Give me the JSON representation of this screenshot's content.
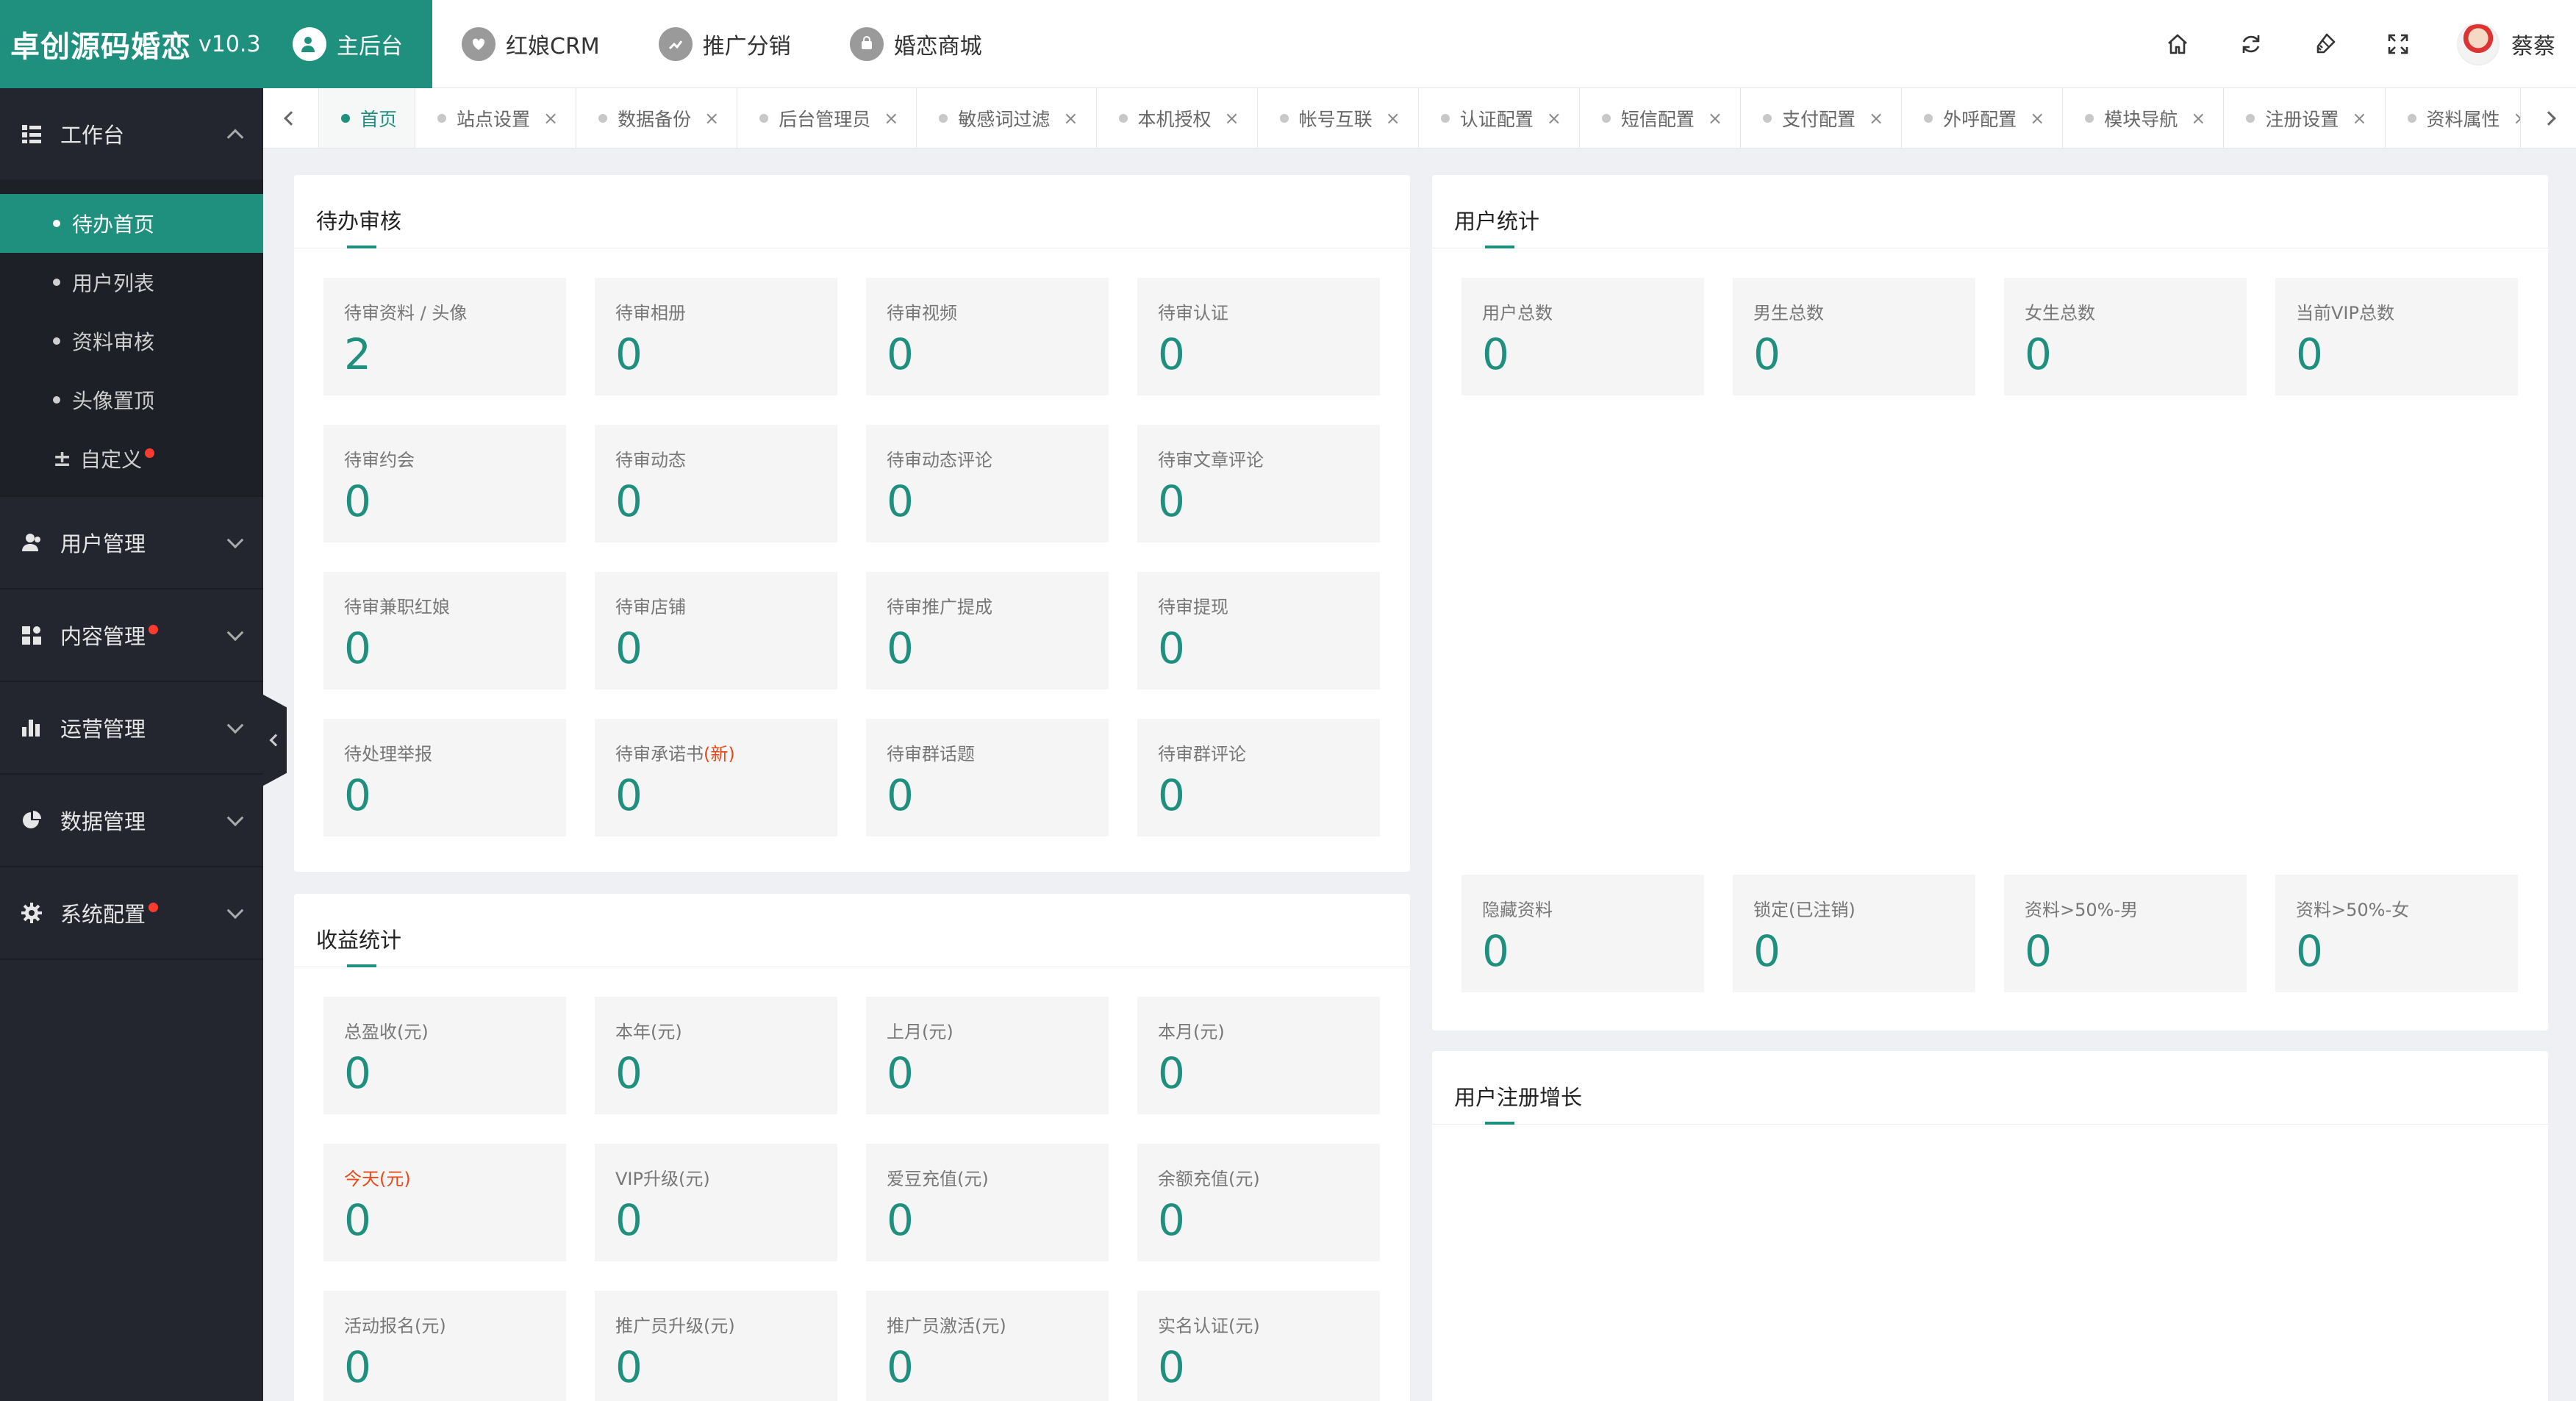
{
  "brand": {
    "name": "卓创源码婚恋",
    "version": "v10.3"
  },
  "sidebar": {
    "workbench": {
      "label": "工作台",
      "items": [
        {
          "label": "待办首页"
        },
        {
          "label": "用户列表"
        },
        {
          "label": "资料审核"
        },
        {
          "label": "头像置顶"
        },
        {
          "label": "自定义"
        }
      ]
    },
    "groups": [
      {
        "label": "用户管理"
      },
      {
        "label": "内容管理"
      },
      {
        "label": "运营管理"
      },
      {
        "label": "数据管理"
      },
      {
        "label": "系统配置"
      }
    ]
  },
  "topbar": {
    "tabs": [
      {
        "label": "主后台"
      },
      {
        "label": "红娘CRM"
      },
      {
        "label": "推广分销"
      },
      {
        "label": "婚恋商城"
      }
    ],
    "username": "蔡蔡"
  },
  "page_tabs": [
    {
      "label": "首页"
    },
    {
      "label": "站点设置"
    },
    {
      "label": "数据备份"
    },
    {
      "label": "后台管理员"
    },
    {
      "label": "敏感词过滤"
    },
    {
      "label": "本机授权"
    },
    {
      "label": "帐号互联"
    },
    {
      "label": "认证配置"
    },
    {
      "label": "短信配置"
    },
    {
      "label": "支付配置"
    },
    {
      "label": "外呼配置"
    },
    {
      "label": "模块导航"
    },
    {
      "label": "注册设置"
    },
    {
      "label": "资料属性"
    }
  ],
  "pending": {
    "title": "待办审核",
    "cards": [
      {
        "label": "待审资料 / 头像",
        "value": "2"
      },
      {
        "label": "待审相册",
        "value": "0"
      },
      {
        "label": "待审视频",
        "value": "0"
      },
      {
        "label": "待审认证",
        "value": "0"
      },
      {
        "label": "待审约会",
        "value": "0"
      },
      {
        "label": "待审动态",
        "value": "0"
      },
      {
        "label": "待审动态评论",
        "value": "0"
      },
      {
        "label": "待审文章评论",
        "value": "0"
      },
      {
        "label": "待审兼职红娘",
        "value": "0"
      },
      {
        "label": "待审店铺",
        "value": "0"
      },
      {
        "label": "待审推广提成",
        "value": "0"
      },
      {
        "label": "待审提现",
        "value": "0"
      },
      {
        "label": "待处理举报",
        "value": "0"
      },
      {
        "label": "待审承诺书",
        "label_suffix": "(新)",
        "value": "0"
      },
      {
        "label": "待审群话题",
        "value": "0"
      },
      {
        "label": "待审群评论",
        "value": "0"
      }
    ]
  },
  "revenue": {
    "title": "收益统计",
    "cards": [
      {
        "label": "总盈收(元)",
        "value": "0"
      },
      {
        "label": "本年(元)",
        "value": "0"
      },
      {
        "label": "上月(元)",
        "value": "0"
      },
      {
        "label": "本月(元)",
        "value": "0"
      },
      {
        "label": "今天(元)",
        "value": "0"
      },
      {
        "label": "VIP升级(元)",
        "value": "0"
      },
      {
        "label": "爱豆充值(元)",
        "value": "0"
      },
      {
        "label": "余额充值(元)",
        "value": "0"
      },
      {
        "label": "活动报名(元)",
        "value": "0"
      },
      {
        "label": "推广员升级(元)",
        "value": "0"
      },
      {
        "label": "推广员激活(元)",
        "value": "0"
      },
      {
        "label": "实名认证(元)",
        "value": "0"
      }
    ]
  },
  "user_stats": {
    "title": "用户统计",
    "top_cards": [
      {
        "label": "用户总数",
        "value": "0"
      },
      {
        "label": "男生总数",
        "value": "0"
      },
      {
        "label": "女生总数",
        "value": "0"
      },
      {
        "label": "当前VIP总数",
        "value": "0"
      }
    ],
    "bottom_cards": [
      {
        "label": "隐藏资料",
        "value": "0"
      },
      {
        "label": "锁定(已注销)",
        "value": "0"
      },
      {
        "label": "资料>50%-男",
        "value": "0"
      },
      {
        "label": "资料>50%-女",
        "value": "0"
      }
    ]
  },
  "growth": {
    "title": "用户注册增长"
  },
  "colors": {
    "accent": "#1f8f7e",
    "sidebar": "#23262e",
    "alert": "#e64a19",
    "badge": "#ff3b30"
  },
  "icons": {
    "workbench": "dashboard-icon",
    "groups": [
      "user-icon",
      "content-icon",
      "chart-bar-icon",
      "pie-chart-icon",
      "gear-icon"
    ],
    "topbar": [
      "home-icon",
      "refresh-icon",
      "clear-icon",
      "fullscreen-icon"
    ]
  }
}
